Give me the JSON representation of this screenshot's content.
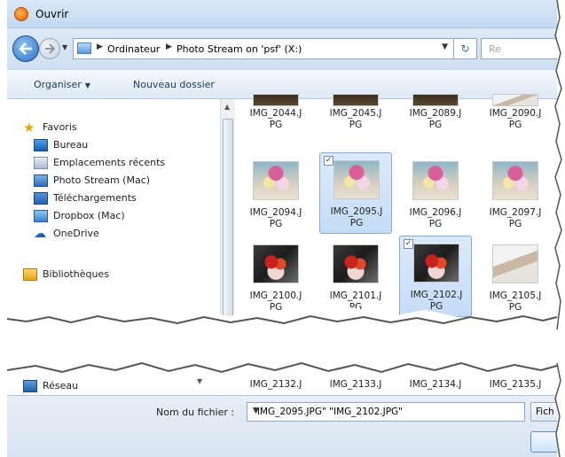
{
  "window": {
    "title": "Ouvrir"
  },
  "address": {
    "crumbs": [
      "Ordinateur",
      "Photo Stream on 'psf' (X:)"
    ],
    "search_placeholder": "Re"
  },
  "toolbar": {
    "organize": "Organiser",
    "new_folder": "Nouveau dossier"
  },
  "nav": {
    "favorites": "Favoris",
    "items": [
      "Bureau",
      "Emplacements récents",
      "Photo Stream (Mac)",
      "Téléchargements",
      "Dropbox (Mac)",
      "OneDrive"
    ],
    "libraries": "Bibliothèques",
    "network": "Réseau"
  },
  "files": {
    "row1": [
      "IMG_2044.J PG",
      "IMG_2045.J PG",
      "IMG_2089.J PG",
      "IMG_2090.J PG"
    ],
    "row2": [
      "IMG_2094.J PG",
      "IMG_2095.J PG",
      "IMG_2096.J PG",
      "IMG_2097.J PG"
    ],
    "row3": [
      "IMG_2100.J PG",
      "IMG_2101.J PG",
      "IMG_2102.J PG",
      "IMG_2105.J PG"
    ],
    "row_bottom": [
      "IMG_2132.J",
      "IMG_2133.J",
      "IMG_2134.J",
      "IMG_2135.J"
    ],
    "selected": [
      "IMG_2095.J PG",
      "IMG_2102.J PG"
    ]
  },
  "filename": {
    "label": "Nom du fichier :",
    "value": "\"IMG_2095.JPG\" \"IMG_2102.JPG\"",
    "filter_label": "Fich"
  }
}
